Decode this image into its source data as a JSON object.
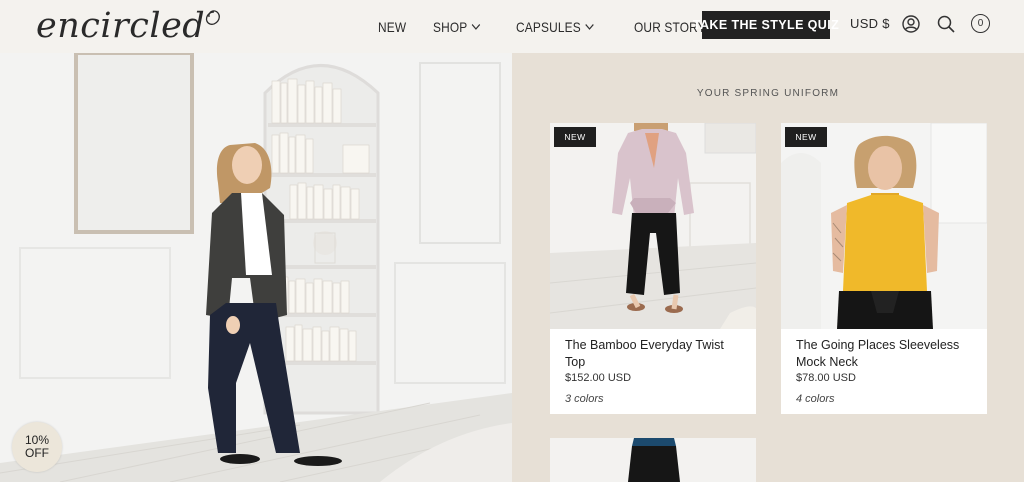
{
  "header": {
    "logo_text": "encircled",
    "nav": [
      {
        "label": "NEW"
      },
      {
        "label": "SHOP"
      },
      {
        "label": "CAPSULES"
      },
      {
        "label": "OUR STORY"
      }
    ],
    "quiz_button": "TAKE THE STYLE QUIZ",
    "currency": "USD $",
    "cart_count": "0",
    "icons": [
      "account-icon",
      "search-icon",
      "cart-icon"
    ]
  },
  "section": {
    "title": "YOUR SPRING UNIFORM"
  },
  "products": [
    {
      "badge": "NEW",
      "title": "The Bamboo Everyday Twist Top",
      "price": "$152.00 USD",
      "colors": "3 colors"
    },
    {
      "badge": "NEW",
      "title": "The Going Places Sleeveless Mock Neck",
      "price": "$78.00 USD",
      "colors": "4 colors"
    }
  ],
  "discount": {
    "line1": "10%",
    "line2": "OFF"
  },
  "colors": {
    "header_bg": "#f4f2ee",
    "panel_bg": "#e7e0d6",
    "button_bg": "#222222"
  }
}
